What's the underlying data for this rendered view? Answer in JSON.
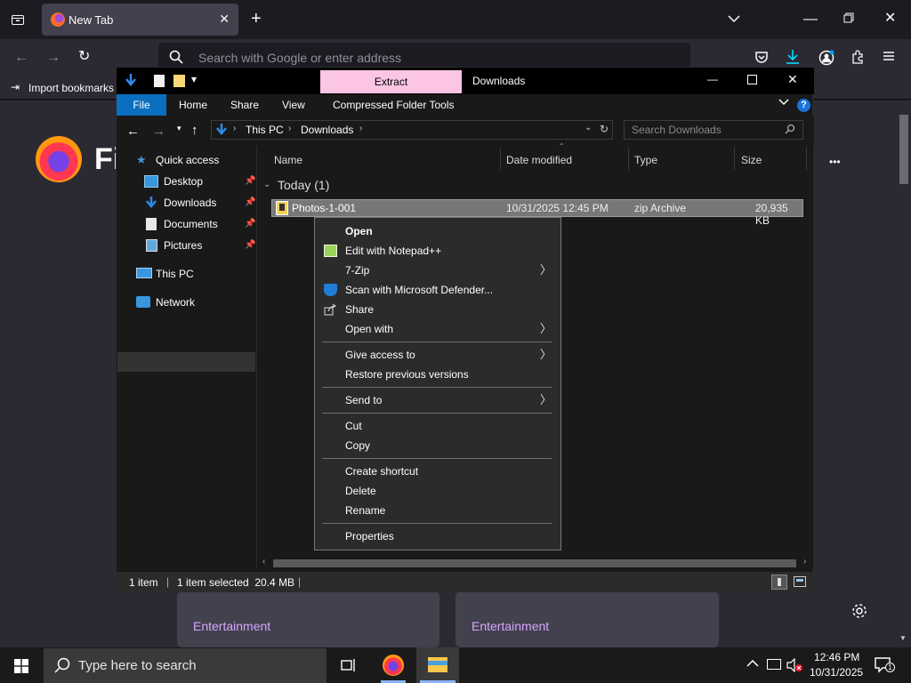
{
  "browser": {
    "tab_title": "New Tab",
    "url_placeholder": "Search with Google or enter address",
    "import_bookmarks": "Import bookmarks",
    "logo_text": "Fi",
    "more_dots": "•••",
    "cards": [
      {
        "category": "Entertainment"
      },
      {
        "category": "Entertainment"
      }
    ]
  },
  "explorer": {
    "context_tab": "Extract",
    "window_title": "Downloads",
    "ribbon": {
      "file": "File",
      "home": "Home",
      "share": "Share",
      "view": "View",
      "tools": "Compressed Folder Tools"
    },
    "breadcrumb": [
      "This PC",
      "Downloads"
    ],
    "search_placeholder": "Search Downloads",
    "nav": {
      "quick_access": "Quick access",
      "desktop": "Desktop",
      "downloads": "Downloads",
      "documents": "Documents",
      "pictures": "Pictures",
      "this_pc": "This PC",
      "network": "Network"
    },
    "columns": {
      "name": "Name",
      "date": "Date modified",
      "type": "Type",
      "size": "Size"
    },
    "group": "Today (1)",
    "files": [
      {
        "name": "Photos-1-001",
        "date": "10/31/2025 12:45 PM",
        "type": "zip Archive",
        "size": "20,935 KB"
      }
    ],
    "status": {
      "count": "1 item",
      "selected": "1 item selected  20.4 MB"
    }
  },
  "context_menu": {
    "open": "Open",
    "edit_notepad": "Edit with Notepad++",
    "zip": "7-Zip",
    "defender": "Scan with Microsoft Defender...",
    "share": "Share",
    "open_with": "Open with",
    "give_access": "Give access to",
    "restore": "Restore previous versions",
    "send_to": "Send to",
    "cut": "Cut",
    "copy": "Copy",
    "create_shortcut": "Create shortcut",
    "delete": "Delete",
    "rename": "Rename",
    "properties": "Properties"
  },
  "taskbar": {
    "search_placeholder": "Type here to search",
    "time": "12:46 PM",
    "date": "10/31/2025",
    "notif_count": "1"
  },
  "colors": {
    "accent": "#0a6fbf",
    "context_tab": "#fdc5e4",
    "card_link": "#d6a7ff"
  }
}
